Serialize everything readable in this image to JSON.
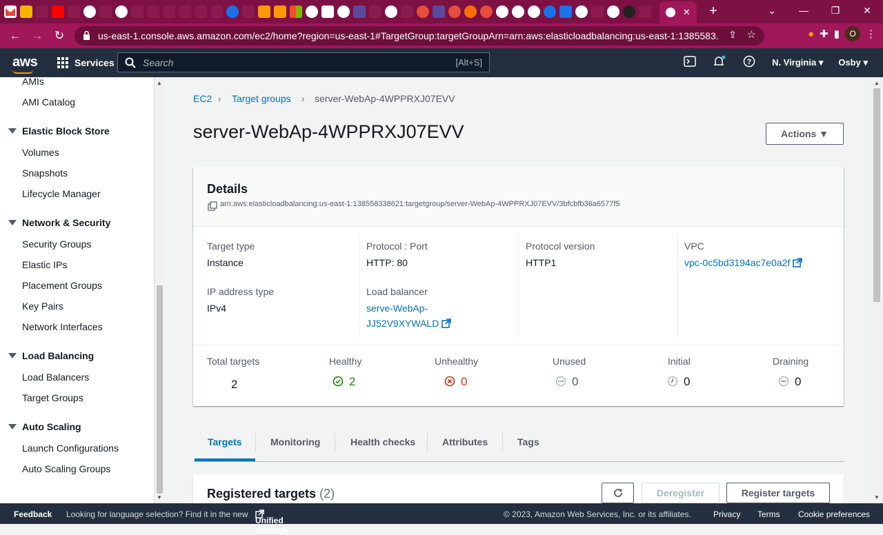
{
  "browser": {
    "url": "us-east-1.console.aws.amazon.com/ec2/home?region=us-east-1#TargetGroup:targetGroupArn=arn:aws:elasticloadbalancing:us-east-1:1385583...",
    "profile_initial": "O"
  },
  "header": {
    "logo": "aws",
    "services_label": "Services",
    "search_placeholder": "Search",
    "search_shortcut": "[Alt+S]",
    "region": "N. Virginia",
    "user": "Osby"
  },
  "sidebar": {
    "top_items": [
      "AMIs",
      "AMI Catalog"
    ],
    "sections": [
      {
        "title": "Elastic Block Store",
        "items": [
          "Volumes",
          "Snapshots",
          "Lifecycle Manager"
        ]
      },
      {
        "title": "Network & Security",
        "items": [
          "Security Groups",
          "Elastic IPs",
          "Placement Groups",
          "Key Pairs",
          "Network Interfaces"
        ]
      },
      {
        "title": "Load Balancing",
        "items": [
          "Load Balancers",
          "Target Groups"
        ]
      },
      {
        "title": "Auto Scaling",
        "items": [
          "Launch Configurations",
          "Auto Scaling Groups"
        ]
      }
    ]
  },
  "breadcrumb": {
    "ec2": "EC2",
    "target_groups": "Target groups",
    "current": "server-WebAp-4WPPRXJ07EVV"
  },
  "page": {
    "title": "server-WebAp-4WPPRXJ07EVV",
    "actions_label": "Actions"
  },
  "details": {
    "title": "Details",
    "arn": "arn:aws:elasticloadbalancing:us-east-1:138558338621:targetgroup/server-WebAp-4WPPRXJ07EVV/3bfcbfb36a6577f5",
    "target_type_label": "Target type",
    "target_type": "Instance",
    "protocol_port_label": "Protocol : Port",
    "protocol_port": "HTTP: 80",
    "protocol_version_label": "Protocol version",
    "protocol_version": "HTTP1",
    "vpc_label": "VPC",
    "vpc": "vpc-0c5bd3194ac7e0a2f",
    "ip_type_label": "IP address type",
    "ip_type": "IPv4",
    "lb_label": "Load balancer",
    "lb_line1": "serve-WebAp-",
    "lb_line2": "JJ52V9XYWALD"
  },
  "stats": {
    "total_label": "Total targets",
    "total": "2",
    "healthy_label": "Healthy",
    "healthy": "2",
    "unhealthy_label": "Unhealthy",
    "unhealthy": "0",
    "unused_label": "Unused",
    "unused": "0",
    "initial_label": "Initial",
    "initial": "0",
    "draining_label": "Draining",
    "draining": "0"
  },
  "tabs": [
    "Targets",
    "Monitoring",
    "Health checks",
    "Attributes",
    "Tags"
  ],
  "registered": {
    "title": "Registered targets",
    "count": "(2)",
    "deregister": "Deregister",
    "register": "Register targets"
  },
  "footer": {
    "feedback": "Feedback",
    "lang_text": "Looking for language selection? Find it in the new",
    "unified": "Unified Settings",
    "copyright": "© 2023, Amazon Web Services, Inc. or its affiliates.",
    "privacy": "Privacy",
    "terms": "Terms",
    "cookies": "Cookie preferences"
  },
  "colors": {
    "tab_strip": "#7d1144",
    "aws_header": "#232f3e",
    "link": "#0073bb",
    "healthy": "#1d8102",
    "unhealthy": "#d13212"
  }
}
